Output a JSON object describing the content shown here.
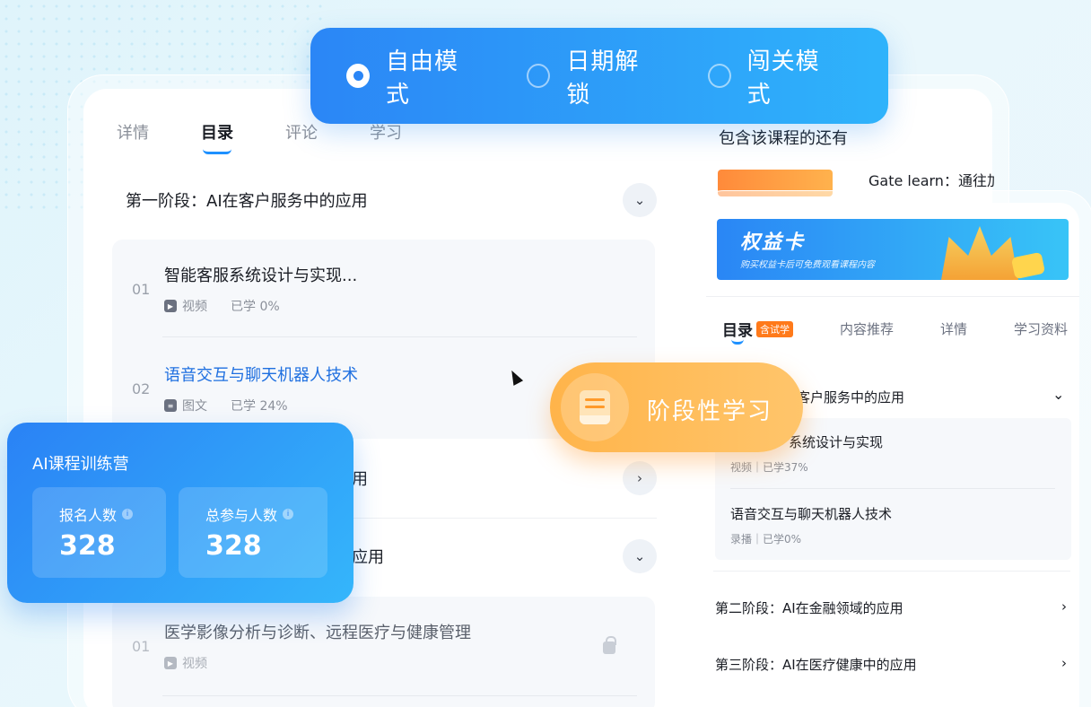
{
  "modes": [
    {
      "label": "自由模式",
      "selected": true
    },
    {
      "label": "日期解锁",
      "selected": false
    },
    {
      "label": "闯关模式",
      "selected": false
    }
  ],
  "main": {
    "tabs": [
      "详情",
      "目录",
      "评论",
      "学习"
    ],
    "active_tab": "目录",
    "stage1": {
      "title": "第一阶段：AI在客户服务中的应用"
    },
    "lessons_stage1": [
      {
        "num": "01",
        "title": "智能客服系统设计与实现...",
        "type": "视频",
        "progress": "已学 0%"
      },
      {
        "num": "02",
        "title": "语音交互与聊天机器人技术",
        "type": "图文",
        "progress": "已学 24%"
      }
    ],
    "stage2_partial": "用",
    "stage3_partial": "应用",
    "lessons_stage3": [
      {
        "num": "01",
        "title": "医学影像分析与诊断、远程医疗与健康管理",
        "type": "视频"
      }
    ]
  },
  "also": {
    "title": "包含该课程的还有",
    "item": "Gate learn：通往加"
  },
  "phone": {
    "vip_title": "权益卡",
    "vip_subtitle": "购买权益卡后可免费观看课程内容",
    "tabs": [
      "目录",
      "内容推荐",
      "详情",
      "学习资料"
    ],
    "trial_badge": "含试学",
    "stage1_partial": "在客户服务中的应用",
    "lessons": [
      {
        "title": "系统设计与实现",
        "meta": "视频｜已学37%"
      },
      {
        "title": "语音交互与聊天机器人技术",
        "meta": "录播｜已学0%"
      }
    ],
    "stage2": "第二阶段：AI在金融领域的应用",
    "stage3": "第三阶段：AI在医疗健康中的应用"
  },
  "stage_badge": {
    "label": "阶段性学习"
  },
  "stats": {
    "title": "AI课程训练营",
    "enrolled_label": "报名人数",
    "enrolled_value": "328",
    "participants_label": "总参与人数",
    "participants_value": "328"
  }
}
